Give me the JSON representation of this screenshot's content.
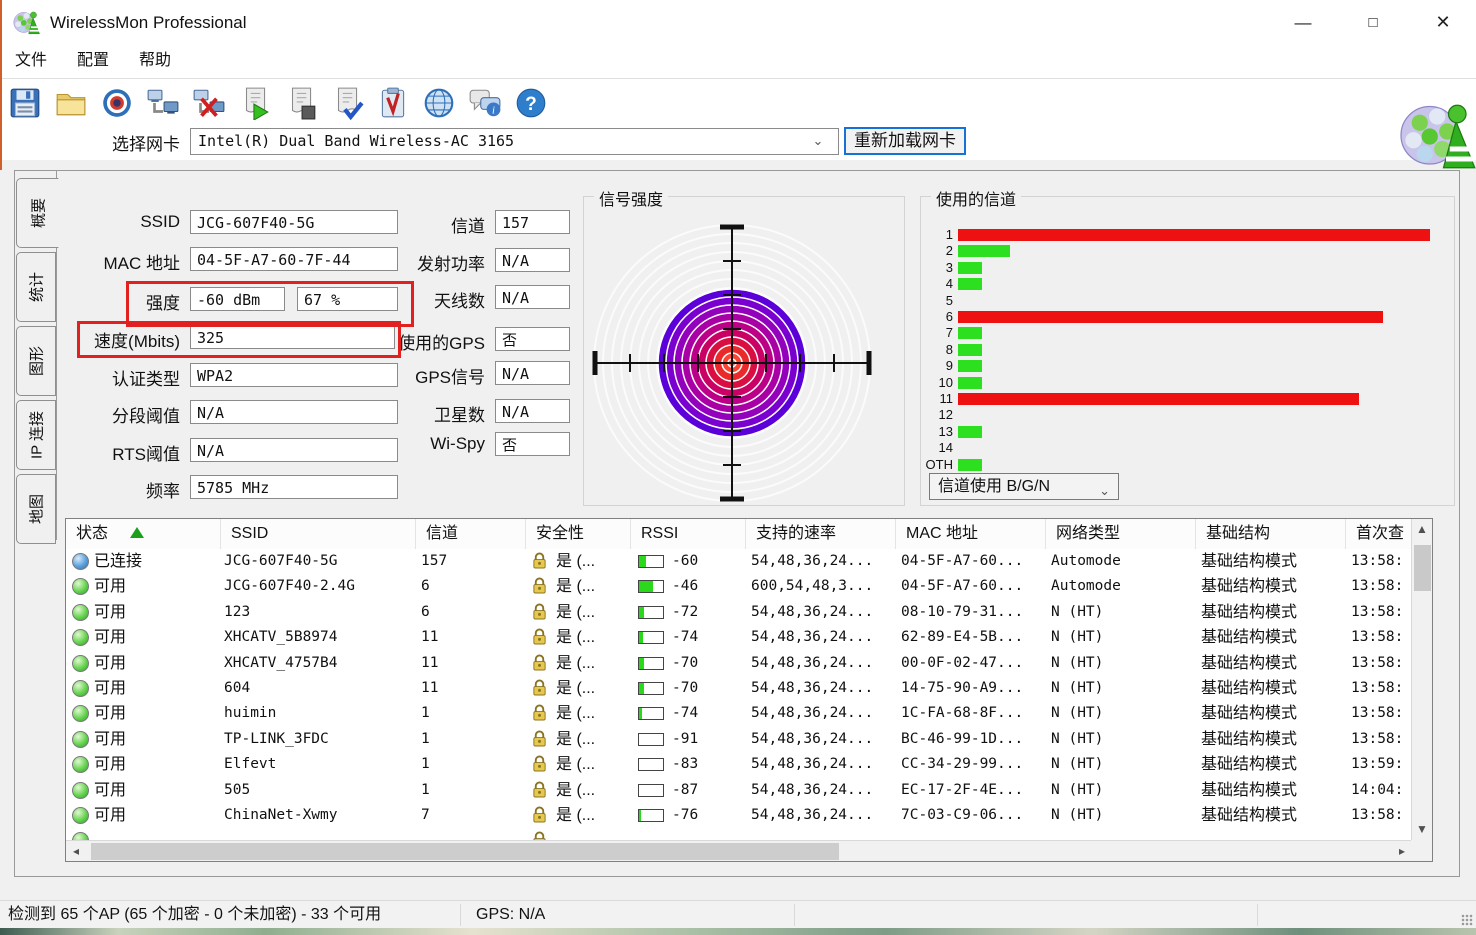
{
  "window": {
    "title": "WirelessMon Professional",
    "controls": {
      "minimize": "—",
      "maximize": "□",
      "close": "✕"
    }
  },
  "menu": {
    "items": [
      "文件",
      "配置",
      "帮助"
    ]
  },
  "toolbar": {
    "icons": [
      "save",
      "open",
      "target",
      "connect-network",
      "disconnect-network",
      "start-log",
      "stop-log",
      "verify-log",
      "report",
      "web",
      "feedback",
      "help"
    ]
  },
  "adapter": {
    "label": "选择网卡",
    "value": "Intel(R) Dual Band Wireless-AC 3165",
    "reload_label": "重新加载网卡"
  },
  "sidebar": {
    "tabs": [
      {
        "label": "概要",
        "active": true
      },
      {
        "label": "统计",
        "active": false
      },
      {
        "label": "图形",
        "active": false
      },
      {
        "label": "IP 连接",
        "active": false
      },
      {
        "label": "地图",
        "active": false
      }
    ]
  },
  "summary": {
    "fields_left": [
      {
        "label": "SSID",
        "values": [
          "JCG-607F40-5G"
        ]
      },
      {
        "label": "MAC 地址",
        "values": [
          "04-5F-A7-60-7F-44"
        ]
      },
      {
        "label": "强度",
        "values": [
          "-60 dBm",
          "67 %"
        ],
        "highlighted": true
      },
      {
        "label": "速度(Mbits)",
        "values": [
          "325"
        ],
        "highlighted": true
      },
      {
        "label": "认证类型",
        "values": [
          "WPA2"
        ]
      },
      {
        "label": "分段阈值",
        "values": [
          "N/A"
        ]
      },
      {
        "label": "RTS阈值",
        "values": [
          "N/A"
        ]
      },
      {
        "label": "频率",
        "values": [
          "5785 MHz"
        ]
      }
    ],
    "fields_mid": [
      {
        "label": "信道",
        "values": [
          "157"
        ]
      },
      {
        "label": "发射功率",
        "values": [
          "N/A"
        ]
      },
      {
        "label": "天线数",
        "values": [
          "N/A"
        ]
      },
      {
        "label": "使用的GPS",
        "values": [
          "否"
        ]
      },
      {
        "label": "GPS信号",
        "values": [
          "N/A"
        ]
      },
      {
        "label": "卫星数",
        "values": [
          "N/A"
        ]
      },
      {
        "label": "Wi-Spy",
        "values": [
          "否"
        ]
      }
    ]
  },
  "signal_panel": {
    "title": "信号强度"
  },
  "channel_panel": {
    "title": "使用的信道",
    "dropdown_value": "信道使用 B/G/N"
  },
  "chart_data": {
    "type": "bar",
    "orientation": "horizontal",
    "title": "使用的信道",
    "categories": [
      "1",
      "2",
      "3",
      "4",
      "5",
      "6",
      "7",
      "8",
      "9",
      "10",
      "11",
      "12",
      "13",
      "14",
      "OTH"
    ],
    "values": [
      100,
      11,
      5,
      5,
      0,
      90,
      5,
      5,
      5,
      5,
      85,
      0,
      5,
      0,
      5
    ],
    "value_unit": "relative bar length, % of longest bar",
    "bar_colors": [
      "#ee1111",
      "#2ce01f",
      "#2ce01f",
      "#2ce01f",
      null,
      "#ee1111",
      "#2ce01f",
      "#2ce01f",
      "#2ce01f",
      "#2ce01f",
      "#ee1111",
      null,
      "#2ce01f",
      null,
      "#2ce01f"
    ],
    "legend_position": "none",
    "grid": false
  },
  "table": {
    "columns": [
      "状态",
      "SSID",
      "信道",
      "安全性",
      "RSSI",
      "支持的速率",
      "MAC 地址",
      "网络类型",
      "基础结构",
      "首次查"
    ],
    "sort": {
      "column": "状态",
      "direction": "asc"
    },
    "rows": [
      {
        "status": "已连接",
        "status_icon": "connected-blue",
        "ssid": "JCG-607F40-5G",
        "channel": "157",
        "security": "是 (...",
        "rssi": "-60",
        "rssi_meter_pct": 30,
        "rates": "54,48,36,24...",
        "mac": "04-5F-A7-60...",
        "network_type": "Automode",
        "infrastructure": "基础结构模式",
        "first_seen": "13:58:"
      },
      {
        "status": "可用",
        "status_icon": "available-green",
        "ssid": "JCG-607F40-2.4G",
        "channel": "6",
        "security": "是 (...",
        "rssi": "-46",
        "rssi_meter_pct": 60,
        "rates": "600,54,48,3...",
        "mac": "04-5F-A7-60...",
        "network_type": "Automode",
        "infrastructure": "基础结构模式",
        "first_seen": "13:58:"
      },
      {
        "status": "可用",
        "status_icon": "available-green",
        "ssid": "123",
        "channel": "6",
        "security": "是 (...",
        "rssi": "-72",
        "rssi_meter_pct": 20,
        "rates": "54,48,36,24...",
        "mac": "08-10-79-31...",
        "network_type": "N (HT)",
        "infrastructure": "基础结构模式",
        "first_seen": "13:58:"
      },
      {
        "status": "可用",
        "status_icon": "available-green",
        "ssid": "XHCATV_5B8974",
        "channel": "11",
        "security": "是 (...",
        "rssi": "-74",
        "rssi_meter_pct": 16,
        "rates": "54,48,36,24...",
        "mac": "62-89-E4-5B...",
        "network_type": "N (HT)",
        "infrastructure": "基础结构模式",
        "first_seen": "13:58:"
      },
      {
        "status": "可用",
        "status_icon": "available-green",
        "ssid": "XHCATV_4757B4",
        "channel": "11",
        "security": "是 (...",
        "rssi": "-70",
        "rssi_meter_pct": 22,
        "rates": "54,48,36,24...",
        "mac": "00-0F-02-47...",
        "network_type": "N (HT)",
        "infrastructure": "基础结构模式",
        "first_seen": "13:58:"
      },
      {
        "status": "可用",
        "status_icon": "available-green",
        "ssid": "604",
        "channel": "11",
        "security": "是 (...",
        "rssi": "-70",
        "rssi_meter_pct": 22,
        "rates": "54,48,36,24...",
        "mac": "14-75-90-A9...",
        "network_type": "N (HT)",
        "infrastructure": "基础结构模式",
        "first_seen": "13:58:"
      },
      {
        "status": "可用",
        "status_icon": "available-green",
        "ssid": "huimin",
        "channel": "1",
        "security": "是 (...",
        "rssi": "-74",
        "rssi_meter_pct": 14,
        "rates": "54,48,36,24...",
        "mac": "1C-FA-68-8F...",
        "network_type": "N (HT)",
        "infrastructure": "基础结构模式",
        "first_seen": "13:58:"
      },
      {
        "status": "可用",
        "status_icon": "available-green",
        "ssid": "TP-LINK_3FDC",
        "channel": "1",
        "security": "是 (...",
        "rssi": "-91",
        "rssi_meter_pct": 0,
        "rates": "54,48,36,24...",
        "mac": "BC-46-99-1D...",
        "network_type": "N (HT)",
        "infrastructure": "基础结构模式",
        "first_seen": "13:58:"
      },
      {
        "status": "可用",
        "status_icon": "available-green",
        "ssid": "Elfevt",
        "channel": "1",
        "security": "是 (...",
        "rssi": "-83",
        "rssi_meter_pct": 0,
        "rates": "54,48,36,24...",
        "mac": "CC-34-29-99...",
        "network_type": "N (HT)",
        "infrastructure": "基础结构模式",
        "first_seen": "13:59:"
      },
      {
        "status": "可用",
        "status_icon": "available-green",
        "ssid": "505",
        "channel": "1",
        "security": "是 (...",
        "rssi": "-87",
        "rssi_meter_pct": 0,
        "rates": "54,48,36,24...",
        "mac": "EC-17-2F-4E...",
        "network_type": "N (HT)",
        "infrastructure": "基础结构模式",
        "first_seen": "14:04:"
      },
      {
        "status": "可用",
        "status_icon": "available-green",
        "ssid": "ChinaNet-Xwmy",
        "channel": "7",
        "security": "是 (...",
        "rssi": "-76",
        "rssi_meter_pct": 10,
        "rates": "54,48,36,24...",
        "mac": "7C-03-C9-06...",
        "network_type": "N (HT)",
        "infrastructure": "基础结构模式",
        "first_seen": "13:58:"
      }
    ]
  },
  "status_bar": {
    "detected": "检测到 65 个AP (65 个加密 - 0 个未加密) - 33 个可用",
    "gps": "GPS: N/A"
  }
}
